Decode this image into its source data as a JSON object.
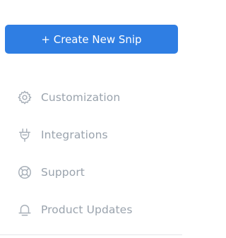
{
  "create_button": {
    "label": "+ Create New Snip"
  },
  "nav": {
    "items": [
      {
        "label": "Customization",
        "icon": "gear-icon"
      },
      {
        "label": "Integrations",
        "icon": "plug-icon"
      },
      {
        "label": "Support",
        "icon": "lifebuoy-icon"
      },
      {
        "label": "Product Updates",
        "icon": "bell-icon"
      }
    ]
  },
  "colors": {
    "accent": "#2f7ee3",
    "nav_text": "#9aa3ad",
    "nav_icon": "#a8b0b9",
    "divider": "#e4e6ea"
  }
}
